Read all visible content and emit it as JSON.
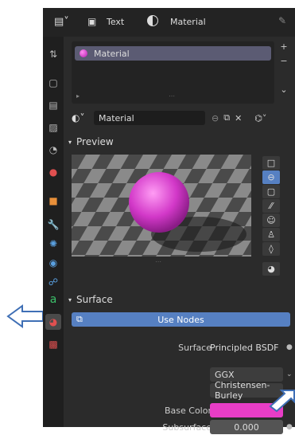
{
  "header": {
    "object_tab": "Text",
    "material_tab": "Material"
  },
  "material_slot": {
    "name": "Material"
  },
  "material_selector": {
    "name": "Material"
  },
  "panels": {
    "preview": "Preview",
    "surface": "Surface"
  },
  "use_nodes_label": "Use Nodes",
  "properties": [
    {
      "label": "Surface",
      "value": "Principled BSDF"
    },
    {
      "label": "",
      "value": "GGX"
    },
    {
      "label": "",
      "value": "Christensen-Burley"
    },
    {
      "label": "Base Color",
      "value": ""
    },
    {
      "label": "Subsurface",
      "value": "0.000"
    }
  ],
  "colors": {
    "accent": "#5680c2",
    "base_color": "#e83dc6"
  },
  "icons": {
    "arrow_left": "arrow-left-icon",
    "arrow_right": "arrow-right-icon"
  }
}
